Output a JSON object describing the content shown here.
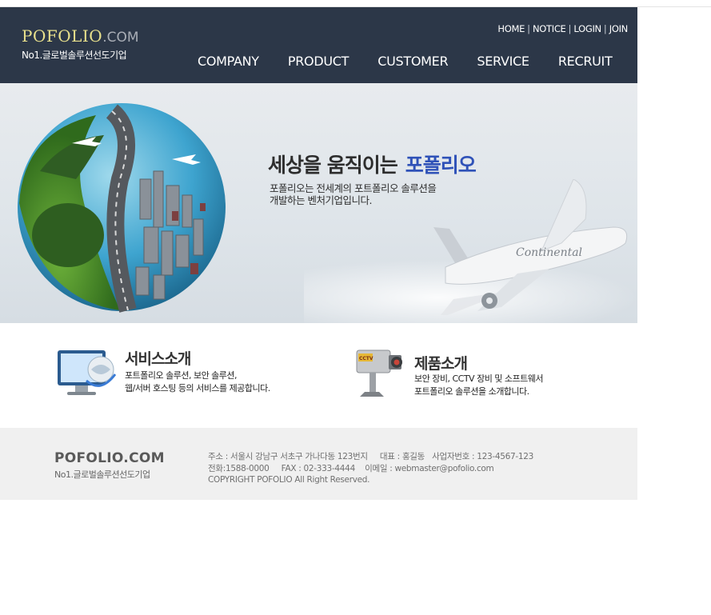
{
  "header": {
    "logo_main": "POFOLIO",
    "logo_domain": ".COM",
    "logo_tagline": "No1.글로벌솔루션선도기업",
    "utility_links": [
      "HOME",
      "NOTICE",
      "LOGIN",
      "JOIN"
    ],
    "nav": [
      "COMPANY",
      "PRODUCT",
      "CUSTOMER",
      "SERVICE",
      "RECRUIT"
    ]
  },
  "banner": {
    "headline": "세상을 움직이는",
    "headline_highlight": "포폴리오",
    "subcopy_line1": "포폴리오는 전세계의 포트폴리오 솔루션을",
    "subcopy_line2": "개발하는 벤처기업입니다.",
    "airplane_livery": "Continental",
    "highlight_color": "#2f52b8"
  },
  "services": [
    {
      "icon": "monitor-globe-icon",
      "title": "서비스소개",
      "desc_line1": "포트폴리오 솔루션, 보안 솔루션,",
      "desc_line2": "웹/서버 호스팅 등의 서비스를 제공합니다."
    },
    {
      "icon": "cctv-camera-icon",
      "title": "제품소개",
      "desc_line1": "보안 장비, CCTV 장비 및 소프트웨서",
      "desc_line2": "포트폴리오 솔루션을 소개합니다.",
      "icon_label": "CCTV"
    }
  ],
  "footer": {
    "logo": "POFOLIO.COM",
    "tagline": "No1.글로벌솔루션선도기업",
    "line1": "주소 : 서울시 강남구 서초구 가나다동 123번지     대표 : 홍길동   사업자번호 : 123-4567-123",
    "line2": "전화:1588-0000     FAX : 02-333-4444    이메일 : webmaster@pofolio.com",
    "line3": "COPYRIGHT POFOLIO All Right Reserved."
  },
  "colors": {
    "header_bg": "#2c3748",
    "logo_accent": "#e8e08c",
    "footer_bg": "#f0f0f0"
  }
}
